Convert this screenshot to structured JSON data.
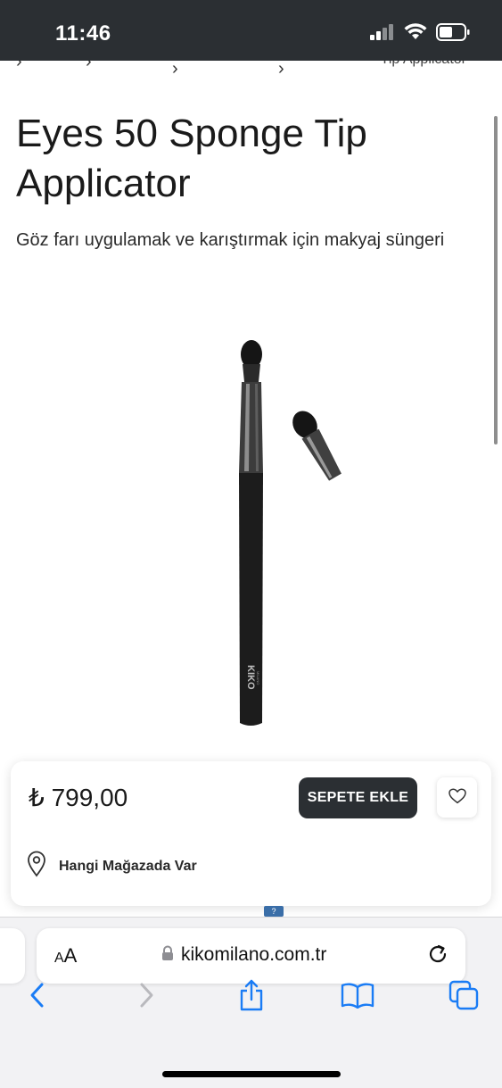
{
  "status_bar": {
    "time": "11:46"
  },
  "breadcrumb": {
    "current": "Tip Applicator"
  },
  "product": {
    "title": "Eyes 50 Sponge Tip Applicator",
    "subtitle": "Göz farı uygulamak ve karıştırmak için makyaj süngeri",
    "brush_brand": "KIKO",
    "brush_sub": "MILANO"
  },
  "purchase": {
    "price": "₺ 799,00",
    "add_to_cart_label": "SEPETE EKLE",
    "store_availability_label": "Hangi Mağazada Var"
  },
  "misc": {
    "badge": "?"
  },
  "browser": {
    "aa_small": "A",
    "aa_large": "A",
    "url": "kikomilano.com.tr"
  },
  "icons": {
    "signal": "signal-icon",
    "wifi": "wifi-icon",
    "battery": "battery-icon",
    "heart": "heart-icon",
    "location": "location-pin-icon",
    "lock": "lock-icon",
    "reload": "reload-icon",
    "back": "chevron-left-icon",
    "forward": "chevron-right-icon",
    "share": "share-icon",
    "bookmarks": "book-icon",
    "tabs": "tabs-icon"
  },
  "colors": {
    "dark": "#2b2f33",
    "safari_blue": "#1a7cf5",
    "disabled": "#b9b9bd"
  }
}
